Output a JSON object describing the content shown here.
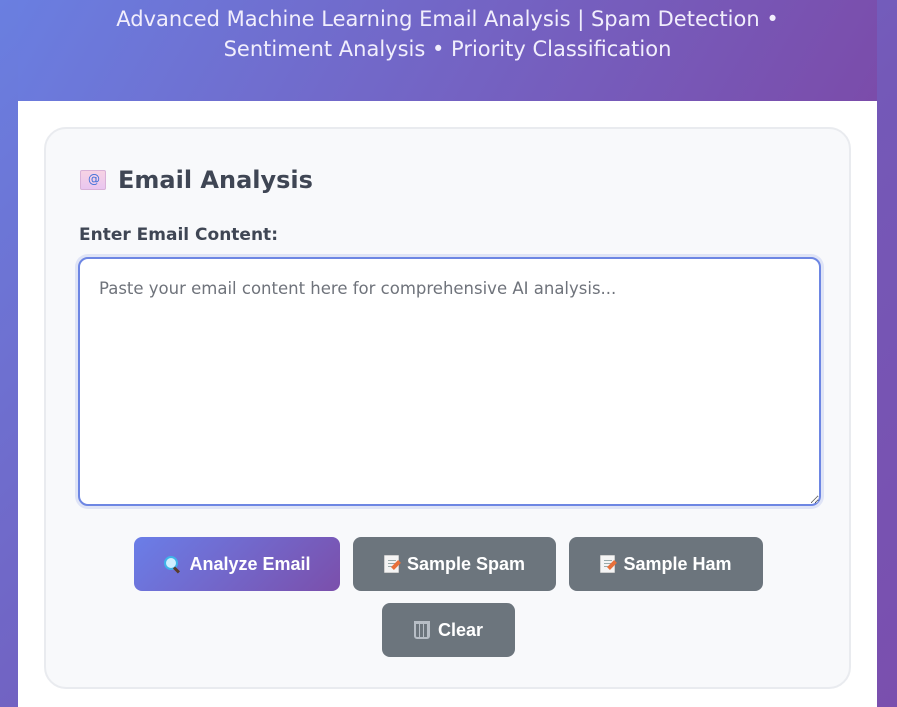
{
  "header": {
    "subtitle": "Advanced Machine Learning Email Analysis | Spam Detection • Sentiment Analysis • Priority Classification"
  },
  "card": {
    "title": "Email Analysis",
    "title_icon": "email-icon",
    "field_label": "Enter Email Content:",
    "textarea": {
      "placeholder": "Paste your email content here for comprehensive AI analysis...",
      "value": ""
    }
  },
  "buttons": {
    "analyze": {
      "label": "Analyze Email",
      "icon": "magnifier-icon"
    },
    "sample_spam": {
      "label": "Sample Spam",
      "icon": "memo-icon"
    },
    "sample_ham": {
      "label": "Sample Ham",
      "icon": "memo-icon"
    },
    "clear": {
      "label": "Clear",
      "icon": "wastebasket-icon"
    }
  },
  "colors": {
    "accent_start": "#667eea",
    "accent_end": "#764ba2",
    "secondary_button": "#6c757d",
    "input_border": "#6d86e3"
  }
}
